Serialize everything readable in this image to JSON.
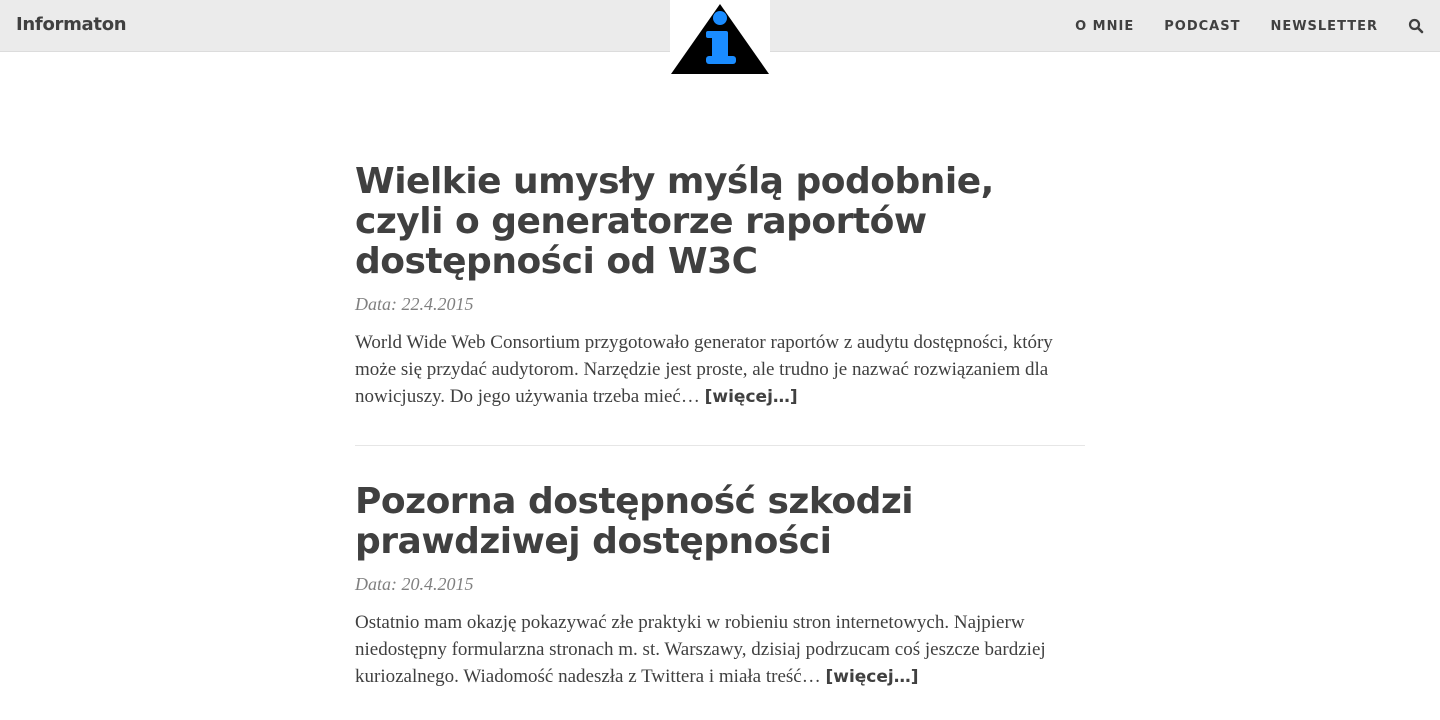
{
  "navbar": {
    "brand": "Informaton",
    "links": [
      "O MNIE",
      "PODCAST",
      "NEWSLETTER"
    ],
    "logo_colors": {
      "triangle": "#000000",
      "letter": "#1a8cff"
    }
  },
  "posts": [
    {
      "title": "Wielkie umysły myślą podobnie, czyli o generatorze raportów dostępności od W3C",
      "date": "Data: 22.4.2015",
      "excerpt": "World Wide Web Consortium przygotowało generator raportów z audytu dostępności, który może się przydać audytorom. Narzędzie jest proste, ale trudno je nazwać rozwiązaniem dla nowicjuszy. Do jego używania trzeba mieć…",
      "more": "[więcej…]"
    },
    {
      "title": "Pozorna dostępność szkodzi prawdziwej dostępności",
      "date": "Data: 20.4.2015",
      "excerpt": "Ostatnio mam okazję pokazywać złe praktyki w robieniu stron internetowych. Najpierw niedostępny formularzna stronach m. st. Warszawy, dzisiaj podrzucam coś jeszcze bardziej kuriozalnego. Wiadomość nadeszła z Twittera i miała treść…",
      "more": "[więcej…]"
    }
  ]
}
